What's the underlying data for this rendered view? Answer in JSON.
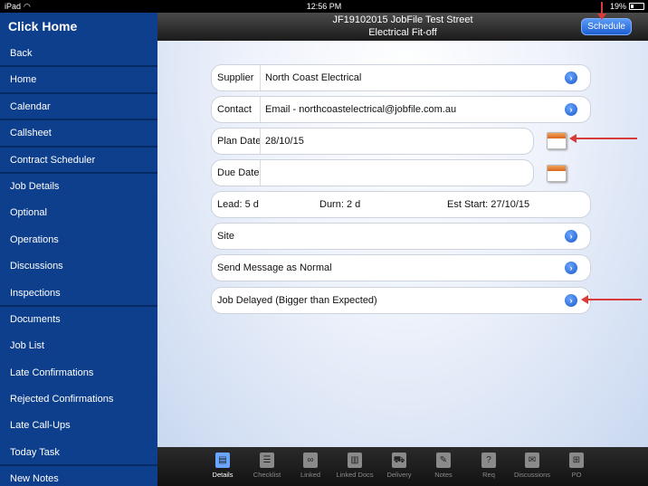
{
  "status": {
    "carrier": "iPad",
    "time": "12:56 PM",
    "battery": "19%"
  },
  "sidebar": {
    "title": "Click Home",
    "items": [
      {
        "label": "Back"
      },
      {
        "label": "Home"
      },
      {
        "label": "Calendar"
      },
      {
        "label": "Callsheet"
      },
      {
        "label": "Contract Scheduler"
      },
      {
        "label": "Job Details"
      },
      {
        "label": "Optional"
      },
      {
        "label": "Operations"
      },
      {
        "label": "Discussions"
      },
      {
        "label": "Inspections"
      },
      {
        "label": "Documents"
      },
      {
        "label": "Job List"
      },
      {
        "label": "Late Confirmations"
      },
      {
        "label": "Rejected Confirmations"
      },
      {
        "label": "Late Call-Ups"
      },
      {
        "label": "Today Task"
      },
      {
        "label": "New Notes"
      }
    ]
  },
  "header": {
    "title": "JF19102015 JobFile Test Street",
    "subtitle": "Electrical Fit-off",
    "schedule_label": "Schedule"
  },
  "form": {
    "supplier_label": "Supplier",
    "supplier_value": "North Coast Electrical",
    "contact_label": "Contact",
    "contact_value": "Email - northcoastelectrical@jobfile.com.au",
    "plan_date_label": "Plan Date",
    "plan_date_value": "28/10/15",
    "due_date_label": "Due Date",
    "due_date_value": "",
    "lead": "Lead: 5 d",
    "durn": "Durn: 2 d",
    "est_start": "Est Start: 27/10/15",
    "site_label": "Site",
    "message_label": "Send Message as Normal",
    "delayed_label": "Job Delayed (Bigger than Expected)"
  },
  "tabs": [
    {
      "label": "Details",
      "icon": "document-icon"
    },
    {
      "label": "Checklist",
      "icon": "checklist-icon"
    },
    {
      "label": "Linked",
      "icon": "link-icon"
    },
    {
      "label": "Linked Docs",
      "icon": "docs-icon"
    },
    {
      "label": "Delivery",
      "icon": "truck-icon"
    },
    {
      "label": "Notes",
      "icon": "notes-icon"
    },
    {
      "label": "Req",
      "icon": "request-icon"
    },
    {
      "label": "Discussions",
      "icon": "chat-icon"
    },
    {
      "label": "PO",
      "icon": "cart-icon"
    }
  ],
  "colors": {
    "sidebar": "#0e3f8c",
    "accent": "#1e5ed2",
    "annotation": "#d93a3a"
  }
}
